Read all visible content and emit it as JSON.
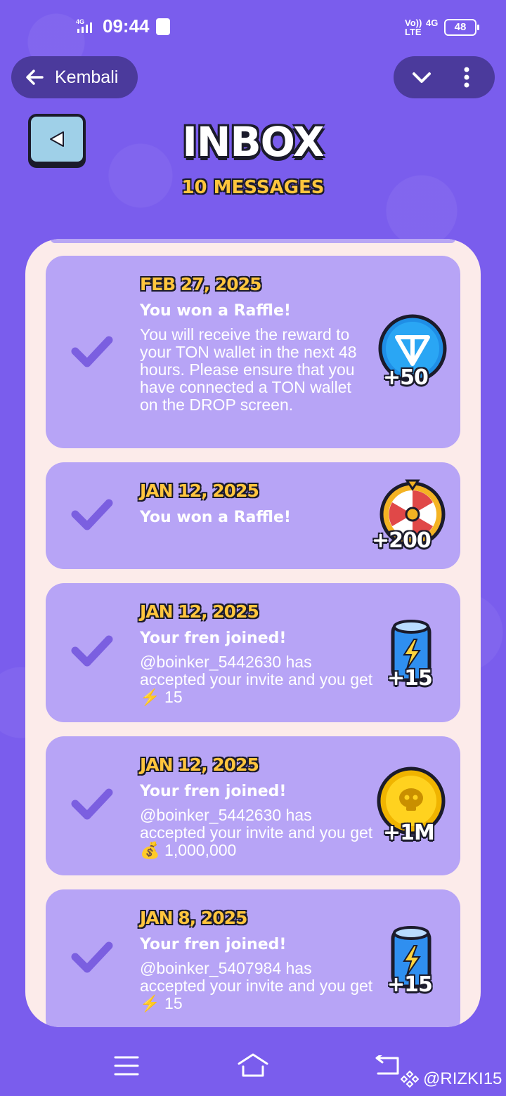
{
  "status_bar": {
    "network": "4G",
    "time": "09:44",
    "volte": "Vo)) LTE",
    "data_type": "4G",
    "battery": "48"
  },
  "nav": {
    "back_label": "Kembali"
  },
  "header": {
    "title": "INBOX",
    "count_label": "10 MESSAGES"
  },
  "messages": [
    {
      "date": "FEB 27, 2025",
      "title": "You won a Raffle!",
      "body": "You will receive the reward to your TON wallet in the next 48 hours. Please ensure that you have connected a TON wallet on the DROP screen.",
      "reward_icon": "ton-coin-icon",
      "reward_amount": "+50"
    },
    {
      "date": "JAN 12, 2025",
      "title": "You won a Raffle!",
      "body": "",
      "reward_icon": "wheel-spin-icon",
      "reward_amount": "+200"
    },
    {
      "date": "JAN 12, 2025",
      "title": "Your fren joined!",
      "body": "@boinker_5442630 has accepted your invite and you get ⚡ 15",
      "reward_icon": "energy-battery-icon",
      "reward_amount": "+15"
    },
    {
      "date": "JAN 12, 2025",
      "title": "Your fren joined!",
      "body": "@boinker_5442630 has accepted your invite and you get 💰 1,000,000",
      "reward_icon": "gold-coin-icon",
      "reward_amount": "+1M"
    },
    {
      "date": "JAN 8, 2025",
      "title": "Your fren joined!",
      "body": "@boinker_5407984 has accepted your invite and you get ⚡ 15",
      "reward_icon": "energy-battery-icon",
      "reward_amount": "+15"
    }
  ],
  "watermark": "@RIZKI15",
  "colors": {
    "background": "#7a5ded",
    "card": "#b7a4f6",
    "panel": "#fcebea",
    "date_accent": "#ffc53d",
    "pill": "#4b3a9c"
  }
}
